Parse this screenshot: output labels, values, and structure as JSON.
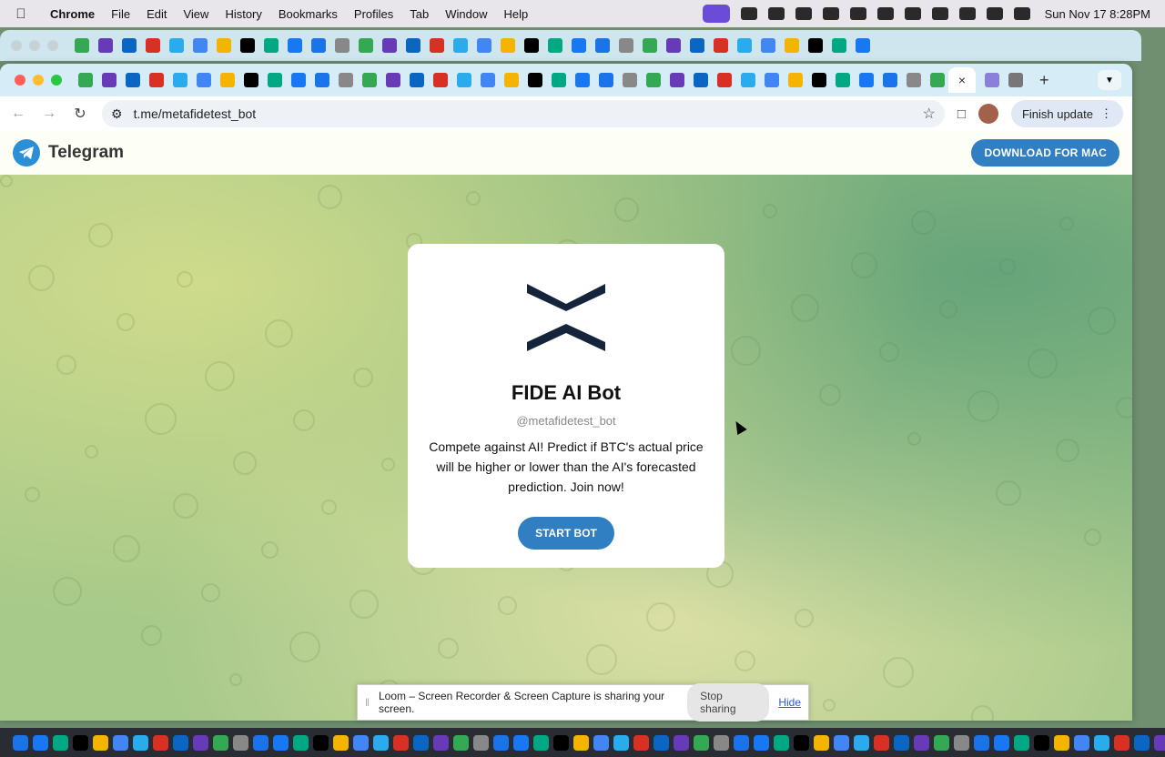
{
  "menubar": {
    "apple": "",
    "app_name": "Chrome",
    "menus": [
      "File",
      "Edit",
      "View",
      "History",
      "Bookmarks",
      "Profiles",
      "Tab",
      "Window",
      "Help"
    ],
    "clock": "Sun Nov 17  8:28PM"
  },
  "browser": {
    "active_tab_close": "×",
    "new_tab": "+",
    "url": "t.me/metafidetest_bot",
    "finish_update": "Finish update"
  },
  "telegram": {
    "brand": "Telegram",
    "download_button": "DOWNLOAD FOR MAC"
  },
  "bot_card": {
    "name": "FIDE AI Bot",
    "handle": "@metafidetest_bot",
    "description": "Compete against AI! Predict if BTC's actual price will be higher or lower than the AI's forecasted prediction. Join now!",
    "start_button": "START BOT"
  },
  "loom": {
    "message": "Loom – Screen Recorder & Screen Capture is sharing your screen.",
    "stop_button": "Stop sharing",
    "hide_link": "Hide"
  },
  "colors": {
    "accent": "#2f7fc2",
    "telegram_blue": "#2b8fd6",
    "menubar_bg": "#e8e6ea",
    "tabstrip_bg": "#d6ecf6"
  }
}
